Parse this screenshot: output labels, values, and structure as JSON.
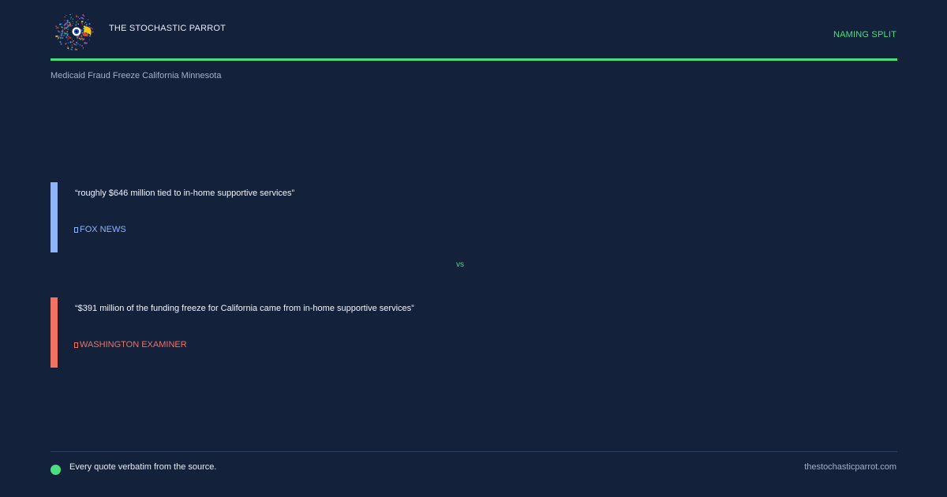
{
  "brand": {
    "name": "THE STOCHASTIC PARROT",
    "logo_icon": "parrot-logo-icon"
  },
  "header": {
    "tag": "NAMING SPLIT",
    "accent_color": "#4ade80"
  },
  "topic": "Medicaid Fraud Freeze California Minnesota",
  "quotes": [
    {
      "text": "“roughly $646 million tied to in-home supportive services”",
      "source": "FOX NEWS",
      "source_icon": "document-icon",
      "color": "#8fb4f8"
    },
    {
      "text": "“$391 million of the funding freeze for California came from in-home supportive services”",
      "source": "WASHINGTON EXAMINER",
      "source_icon": "document-icon",
      "color": "#f07261"
    }
  ],
  "divider": "vs",
  "footer": {
    "note": "Every quote verbatim from the source.",
    "domain": "thestochasticparrot.com"
  },
  "colors": {
    "background": "#13213b"
  }
}
